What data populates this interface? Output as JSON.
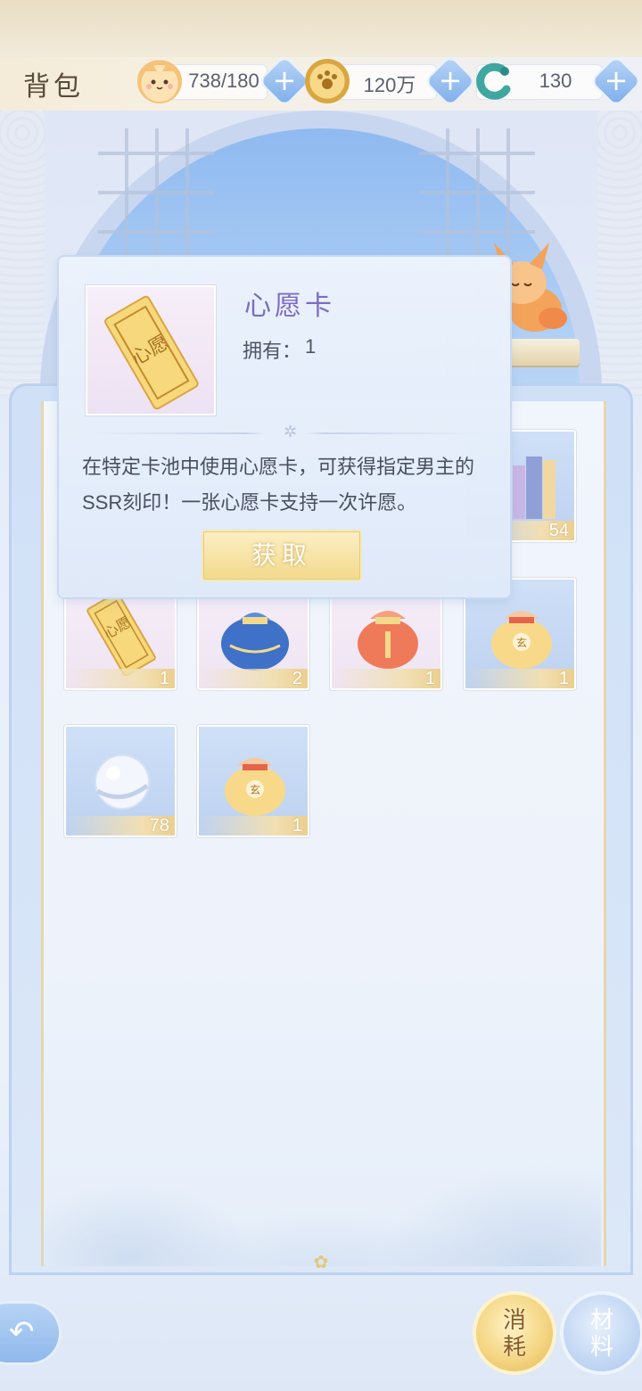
{
  "header": {
    "title": "背包",
    "resources": [
      {
        "icon": "cat-stamina-icon",
        "value": "738/180"
      },
      {
        "icon": "paw-coin-icon",
        "value": "120万"
      },
      {
        "icon": "jade-dragon-icon",
        "value": "130"
      }
    ],
    "plus_label": "+"
  },
  "popup": {
    "item_name": "心愿卡",
    "own_label": "拥有：",
    "own_value": "1",
    "description": "在特定卡池中使用心愿卡，可获得指定男主的SSR刻印！一张心愿卡支持一次许愿。",
    "get_button": "获取",
    "thumb_icon": "wish-card-icon",
    "thumb_text": "心愿",
    "divider_glyph": "✲"
  },
  "items": [
    {
      "icon": "wish-card-icon",
      "count": "1",
      "bg": "pink"
    },
    {
      "icon": "blue-pouch-icon",
      "count": "2",
      "bg": "pink"
    },
    {
      "icon": "red-pouch-icon",
      "count": "1",
      "bg": "pink"
    },
    {
      "icon": "gold-pouch-icon",
      "count": "1",
      "bg": "blue"
    },
    {
      "icon": "pearl-icon",
      "count": "78",
      "bg": "blue"
    },
    {
      "icon": "gold-pouch-icon",
      "count": "1",
      "bg": "blue"
    }
  ],
  "hidden_item": {
    "icon": "book-stack-icon",
    "count": "54"
  },
  "bag_glyph": "玄",
  "tabs": [
    {
      "label": "消耗",
      "active": true
    },
    {
      "label": "材料",
      "active": false
    }
  ],
  "back_glyph": "↶",
  "colors": {
    "accent_gold": "#f3d98b",
    "accent_blue": "#8fb8ec",
    "title_purple": "#7d6bc2"
  }
}
